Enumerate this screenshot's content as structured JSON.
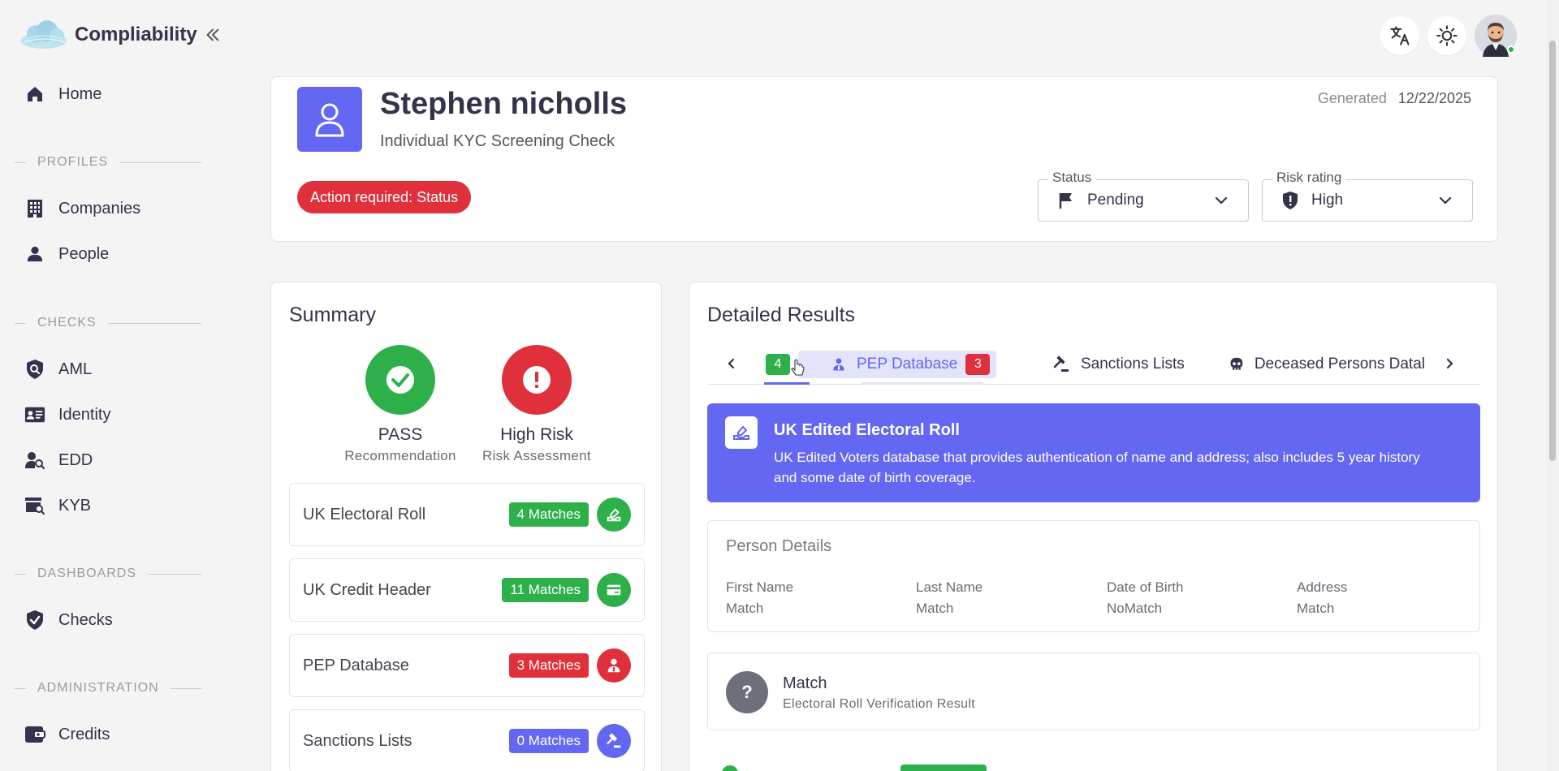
{
  "app": {
    "name": "Compliability",
    "icons": {
      "logo": "cloud-logo",
      "collapse": "double-chevron-left-icon"
    }
  },
  "topbar": {
    "buttons": [
      "translate-icon",
      "theme-sun-icon"
    ],
    "avatar_status_color": "#2db04a"
  },
  "sidebar": {
    "home": "Home",
    "sections": {
      "profiles": "PROFILES",
      "checks": "CHECKS",
      "dashboards": "DASHBOARDS",
      "administration": "ADMINISTRATION"
    },
    "items": {
      "companies": "Companies",
      "people": "People",
      "aml": "AML",
      "identity": "Identity",
      "edd": "EDD",
      "kyb": "KYB",
      "checks": "Checks",
      "credits": "Credits"
    }
  },
  "header": {
    "name": "Stephen nicholls",
    "subtitle": "Individual KYC Screening Check",
    "generated_label": "Generated",
    "generated_date": "12/22/2025",
    "action_pill": "Action required: Status",
    "status": {
      "label": "Status",
      "value": "Pending"
    },
    "risk": {
      "label": "Risk rating",
      "value": "High"
    }
  },
  "summary": {
    "title": "Summary",
    "recommendation": {
      "title": "PASS",
      "subtitle": "Recommendation"
    },
    "risk": {
      "title": "High Risk",
      "subtitle": "Risk Assessment"
    },
    "rows": [
      {
        "label": "UK Electoral Roll",
        "matches": "4 Matches",
        "color": "#2db04a"
      },
      {
        "label": "UK Credit Header",
        "matches": "11 Matches",
        "color": "#2db04a"
      },
      {
        "label": "PEP Database",
        "matches": "3 Matches",
        "color": "#e0303c"
      },
      {
        "label": "Sanctions Lists",
        "matches": "0 Matches",
        "color": "#6467f2"
      }
    ]
  },
  "details": {
    "title": "Detailed Results",
    "tabs": {
      "first_count": "4",
      "pep": {
        "label": "PEP Database",
        "count": "3"
      },
      "sanctions": {
        "label": "Sanctions Lists"
      },
      "deceased": {
        "label": "Deceased Persons Datal"
      }
    },
    "banner": {
      "title": "UK Edited Electoral Roll",
      "description": "UK Edited Voters database that provides authentication of name and address; also includes 5 year history and some date of birth coverage."
    },
    "person_details": {
      "title": "Person Details",
      "fields": [
        {
          "key": "First Name",
          "value": "Match"
        },
        {
          "key": "Last Name",
          "value": "Match"
        },
        {
          "key": "Date of Birth",
          "value": "NoMatch"
        },
        {
          "key": "Address",
          "value": "Match"
        }
      ]
    },
    "match": {
      "title": "Match",
      "subtitle": "Electoral Roll Verification Result"
    }
  },
  "colors": {
    "accent": "#6467f2",
    "success": "#2db04a",
    "danger": "#e0303c"
  }
}
